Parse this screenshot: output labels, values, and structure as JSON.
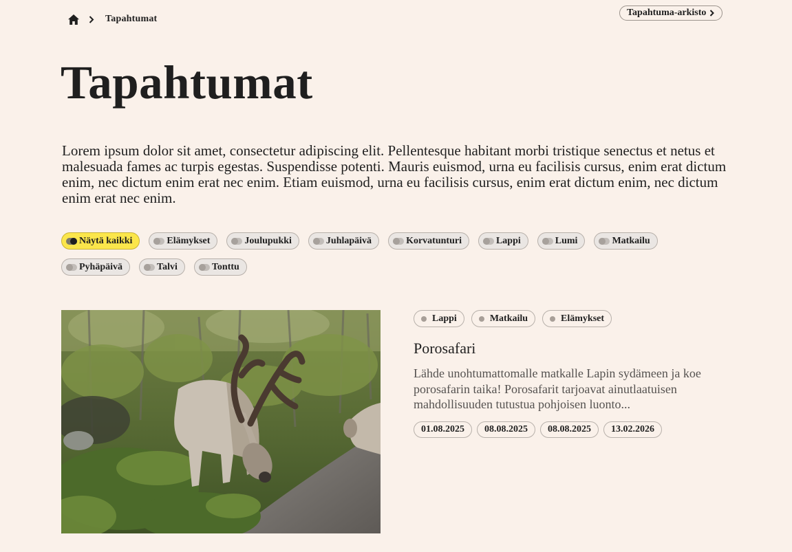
{
  "breadcrumb": {
    "home_icon": "home-icon",
    "separator_icon": "chevron-right-icon",
    "current": "Tapahtumat"
  },
  "archive_link": {
    "label": "Tapahtuma-arkisto",
    "icon": "chevron-right-icon"
  },
  "page": {
    "title": "Tapahtumat",
    "intro": "Lorem ipsum dolor sit amet, consectetur adipiscing elit. Pellentesque habitant morbi tristique senectus et netus et malesuada fames ac turpis egestas. Suspendisse potenti. Mauris euismod, urna eu facilisis cursus, enim erat dictum enim, nec dictum enim erat nec enim. Etiam euismod, urna eu facilisis cursus, enim erat dictum enim, nec dictum enim erat nec enim."
  },
  "filters": {
    "row1": [
      "Näytä kaikki",
      "Elämykset",
      "Joulupukki",
      "Juhlapäivä",
      "Korvatunturi",
      "Lappi",
      "Lumi",
      "Matkailu"
    ],
    "row2": [
      "Pyhäpäivä",
      "Talvi",
      "Tonttu"
    ],
    "active": "Näytä kaikki",
    "active_color": "#fbe64b"
  },
  "event": {
    "tags": [
      "Lappi",
      "Matkailu",
      "Elämykset"
    ],
    "title": "Porosafari",
    "description": "Lähde unohtumattomalle matkalle Lapin sydämeen ja koe porosafarin taika! Porosafarit tarjoavat ainutlaatuisen mahdollisuuden tutustua pohjoisen luonto...",
    "dates": [
      "01.08.2025",
      "08.08.2025",
      "08.08.2025",
      "13.02.2026"
    ],
    "image_subject": "reindeer grazing by a gravel road"
  },
  "colors": {
    "background": "#faf1ea",
    "text": "#1f1f1f",
    "muted_text": "#555250"
  }
}
